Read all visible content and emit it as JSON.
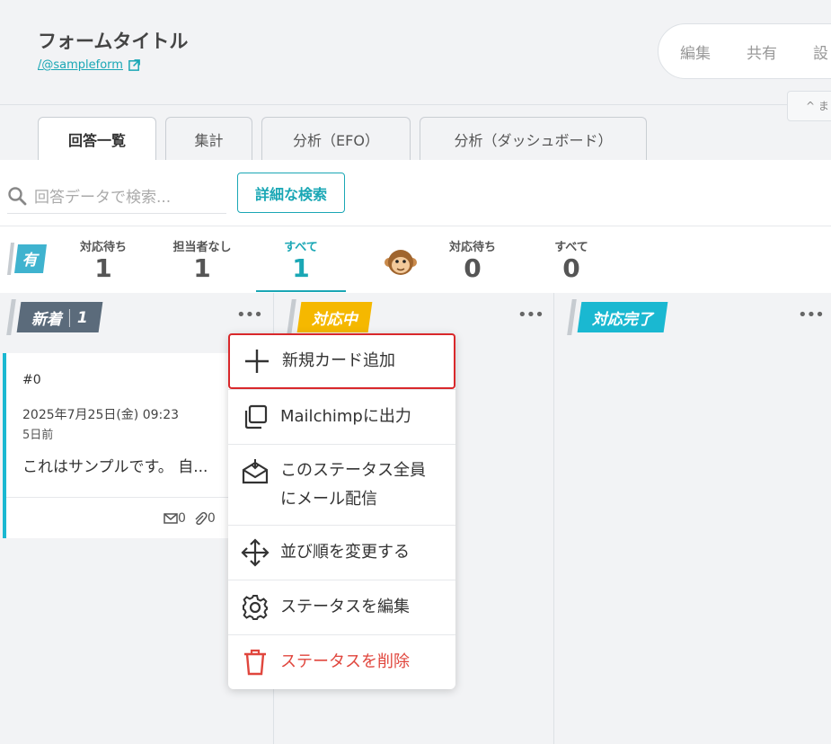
{
  "header": {
    "form_title": "フォームタイトル",
    "form_url": "/@sampleform",
    "actions": [
      "編集",
      "共有",
      "設"
    ],
    "collapse_label": "^ ま"
  },
  "tabs": [
    {
      "label": "回答一覧",
      "active": true
    },
    {
      "label": "集計",
      "active": false
    },
    {
      "label": "分析（EFO）",
      "active": false
    },
    {
      "label": "分析（ダッシュボード）",
      "active": false
    }
  ],
  "search": {
    "placeholder": "回答データで検索...",
    "detail_button": "詳細な検索"
  },
  "summary": {
    "tag_label": "有",
    "stats": [
      {
        "label": "対応待ち",
        "value": "1"
      },
      {
        "label": "担当者なし",
        "value": "1"
      },
      {
        "label": "すべて",
        "value": "1"
      },
      {
        "label": "対応待ち",
        "value": "0"
      },
      {
        "label": "すべて",
        "value": "0"
      }
    ]
  },
  "columns": [
    {
      "label": "新着",
      "count": "1",
      "color": "#5b6b7b"
    },
    {
      "label": "対応中",
      "color": "#f5b800"
    },
    {
      "label": "対応完了",
      "color": "#1ab8d1"
    }
  ],
  "card": {
    "id": "#0",
    "date": "2025年7月25日(金) 09:23",
    "ago": "5日前",
    "text": "これはサンプルです。 自...",
    "mail_count": "0",
    "attach_count": "0"
  },
  "menu": {
    "items": [
      {
        "label": "新規カード追加",
        "icon": "plus-icon"
      },
      {
        "label": "Mailchimpに出力",
        "icon": "copy-icon"
      },
      {
        "label": "このステータス全員",
        "label2": "にメール配信",
        "icon": "mail-open-icon"
      },
      {
        "label": "並び順を変更する",
        "icon": "move-icon"
      },
      {
        "label": "ステータスを編集",
        "icon": "gear-icon"
      },
      {
        "label": "ステータスを削除",
        "icon": "trash-icon"
      }
    ]
  }
}
